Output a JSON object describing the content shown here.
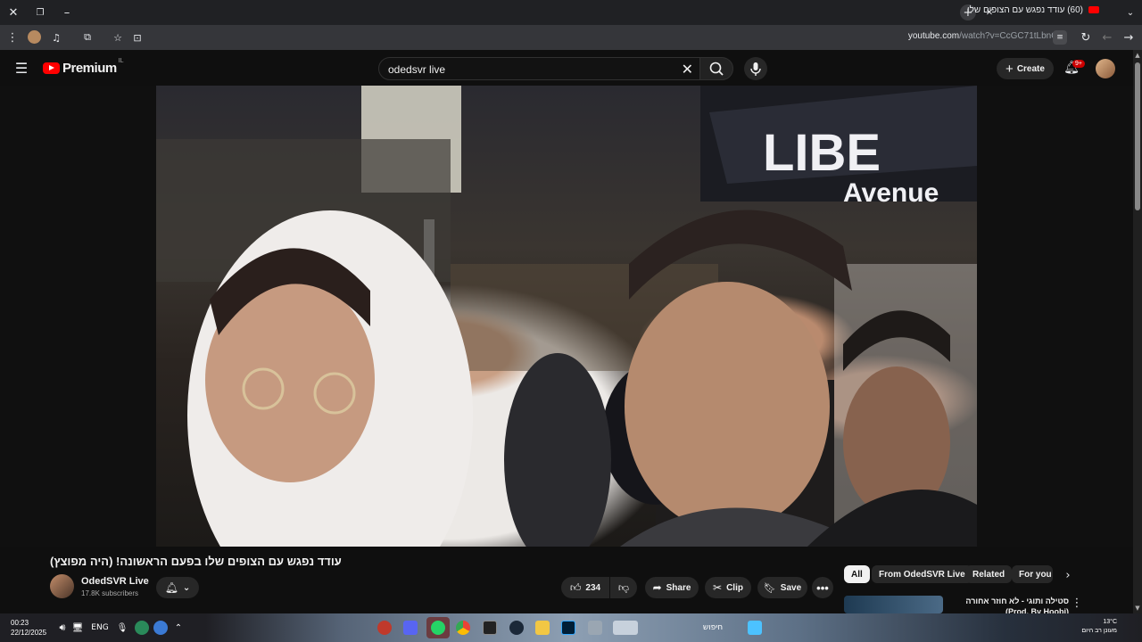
{
  "browser": {
    "tab_title": "(60) עודד נפגש עם הצופים שלו",
    "url_domain": "youtube.com",
    "url_path": "/watch?v=CcGC71tLbnQ"
  },
  "header": {
    "logo_text": "Premium",
    "country_code": "IL",
    "search_query": "odedsvr live",
    "create_label": "Create",
    "notifications_badge": "9+"
  },
  "video": {
    "title": "עודד נפגש עם הצופים שלו בפעם הראשונה! (היה מפוצץ)",
    "channel_name": "OdedSVR Live",
    "subscribers": "17.8K subscribers",
    "likes": "234",
    "share_label": "Share",
    "clip_label": "Clip",
    "save_label": "Save"
  },
  "sidebar": {
    "chips": [
      "All",
      "From OdedSVR Live",
      "Related",
      "For you"
    ],
    "rec_title": "סטילה ותוגי - לא חוזר אחורה (Prod. By Hoobi)"
  },
  "taskbar": {
    "time": "00:23",
    "date": "22/12/2025",
    "lang": "ENG",
    "search_text": "חיפוש",
    "temp": "13°C",
    "weather": "מעונן רב היום"
  }
}
